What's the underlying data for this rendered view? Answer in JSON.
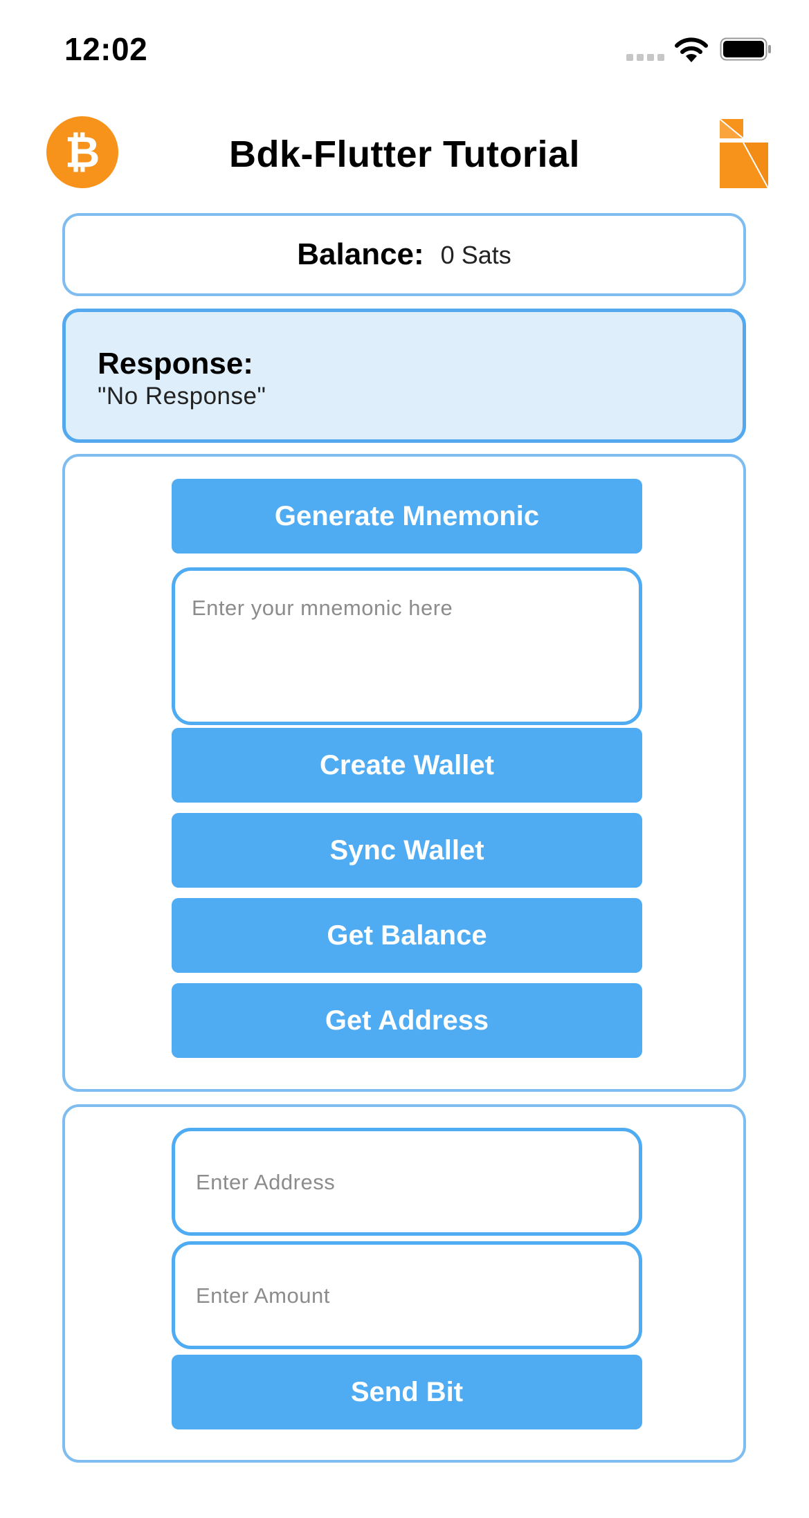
{
  "status_bar": {
    "time": "12:02"
  },
  "header": {
    "title": "Bdk-Flutter Tutorial"
  },
  "balance": {
    "label": "Balance:",
    "value": "0 Sats"
  },
  "response": {
    "label": "Response:",
    "value": "\"No Response\""
  },
  "wallet": {
    "generate_mnemonic": "Generate Mnemonic",
    "mnemonic_placeholder": "Enter your mnemonic here",
    "create_wallet": "Create Wallet",
    "sync_wallet": "Sync Wallet",
    "get_balance": "Get Balance",
    "get_address": "Get Address"
  },
  "send": {
    "address_placeholder": "Enter Address",
    "amount_placeholder": "Enter Amount",
    "send_button": "Send Bit"
  },
  "colors": {
    "accent": "#4fabf2",
    "card_border": "#7fbcf0",
    "response_bg": "#dfeefb",
    "bitcoin_orange": "#f7931a"
  },
  "icons": {
    "status": [
      "cellular-signal-icon",
      "wifi-icon",
      "battery-icon"
    ],
    "header": [
      "bitcoin-logo-icon",
      "bdk-logo-icon"
    ]
  }
}
